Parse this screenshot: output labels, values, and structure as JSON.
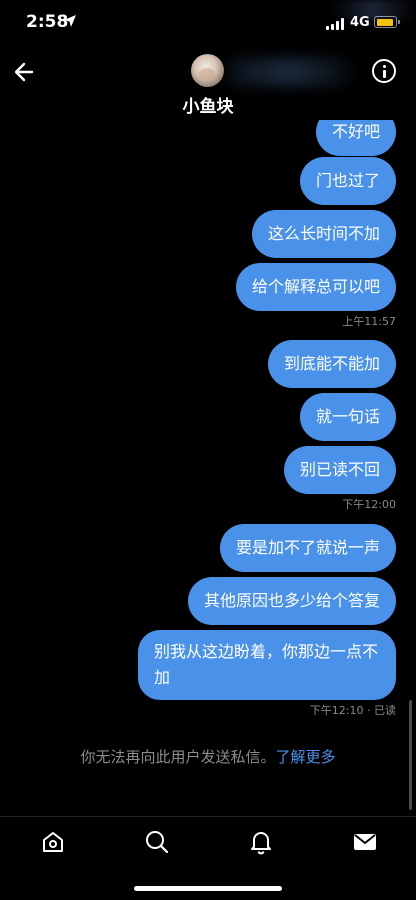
{
  "status_bar": {
    "time": "2:58",
    "network": "4G",
    "battery_color": "#f4c20d"
  },
  "header": {
    "back_icon": "arrow-left-icon",
    "username": "小鱼块",
    "info_icon": "info-icon"
  },
  "messages": [
    {
      "text": "不好吧"
    },
    {
      "text": "门也过了"
    },
    {
      "text": "这么长时间不加"
    },
    {
      "text": "给个解释总可以吧"
    },
    {
      "timestamp": "上午11:57"
    },
    {
      "text": "到底能不能加"
    },
    {
      "text": "就一句话"
    },
    {
      "text": "别已读不回"
    },
    {
      "timestamp": "下午12:00"
    },
    {
      "text": "要是加不了就说一声"
    },
    {
      "text": "其他原因也多少给个答复"
    },
    {
      "text": "别我从这边盼着，你那边一点不加"
    },
    {
      "timestamp": "下午12:10 · 已读"
    }
  ],
  "notice": {
    "text": "你无法再向此用户发送私信。",
    "link": "了解更多"
  },
  "bottom_nav": [
    {
      "icon": "home-icon"
    },
    {
      "icon": "search-icon"
    },
    {
      "icon": "bell-icon"
    },
    {
      "icon": "mail-icon"
    }
  ],
  "accent_color": "#4a92e9"
}
